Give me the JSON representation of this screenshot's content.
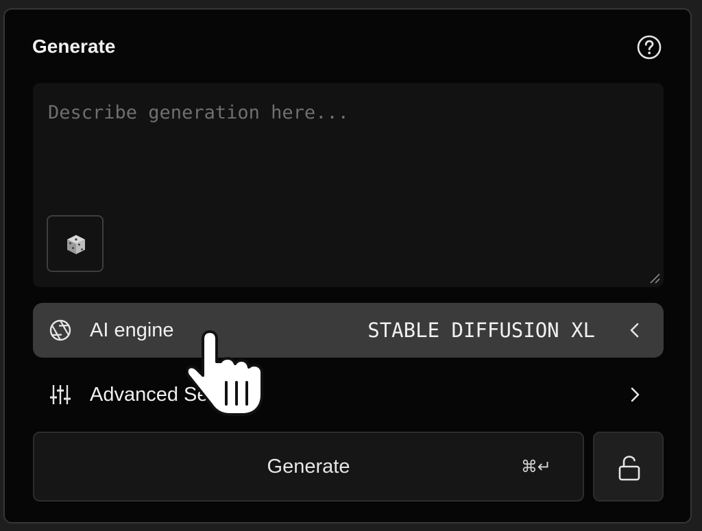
{
  "panel": {
    "title": "Generate",
    "help_icon": "question-circle-icon"
  },
  "prompt": {
    "placeholder": "Describe generation here...",
    "value": "",
    "random_icon": "dice-icon"
  },
  "engine_row": {
    "icon": "aperture-icon",
    "label": "AI engine",
    "value": "STABLE DIFFUSION XL",
    "chevron": "chevron-left-icon"
  },
  "advanced_row": {
    "icon": "sliders-icon",
    "label": "Advanced Settings",
    "chevron": "chevron-right-icon"
  },
  "generate_button": {
    "label": "Generate",
    "shortcut": "⌘↵"
  },
  "lock_button": {
    "icon": "unlock-icon"
  },
  "colors": {
    "panel_bg": "#060606",
    "field_bg": "#121212",
    "active_row_bg": "#3b3b3b",
    "text": "#f0f0f0",
    "placeholder": "#6f6f6f"
  }
}
